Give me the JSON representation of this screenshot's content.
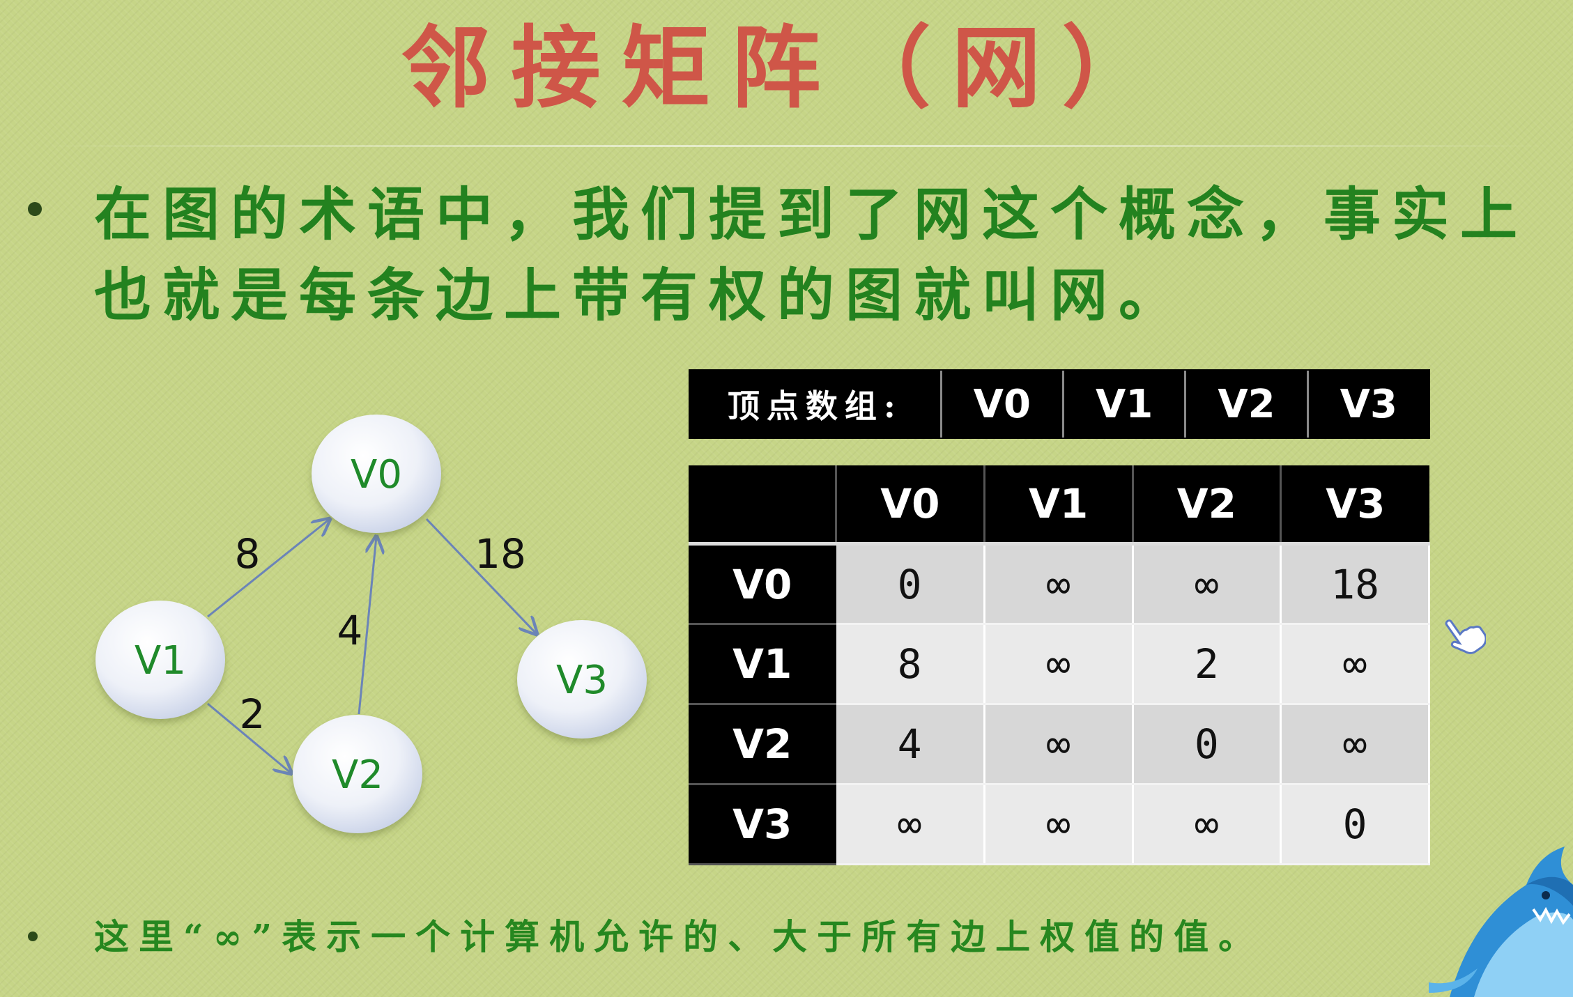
{
  "slide": {
    "title": "邻接矩阵（网）",
    "paragraph1": "在图的术语中，我们提到了网这个概念，事实上也就是每条边上带有权的图就叫网。",
    "paragraph2": "这里“∞”表示一个计算机允许的、大于所有边上权值的值。"
  },
  "graph": {
    "nodes": {
      "v0": "V0",
      "v1": "V1",
      "v2": "V2",
      "v3": "V3"
    },
    "edges": {
      "v1_v0": "8",
      "v0_v3": "18",
      "v2_v0": "4",
      "v1_v2": "2"
    }
  },
  "vertex_array": {
    "header": "顶点数组:",
    "items": [
      "V0",
      "V1",
      "V2",
      "V3"
    ]
  },
  "matrix": {
    "columns": [
      "V0",
      "V1",
      "V2",
      "V3"
    ],
    "rows": [
      {
        "label": "V0",
        "cells": [
          "0",
          "∞",
          "∞",
          "18"
        ]
      },
      {
        "label": "V1",
        "cells": [
          "8",
          "∞",
          "2",
          "∞"
        ]
      },
      {
        "label": "V2",
        "cells": [
          "4",
          "∞",
          "0",
          "∞"
        ]
      },
      {
        "label": "V3",
        "cells": [
          "∞",
          "∞",
          "∞",
          "0"
        ]
      }
    ]
  },
  "icons": {
    "cursor": "pointing-hand-icon",
    "mascot": "shark-mascot"
  },
  "colors": {
    "title": "#cf5648",
    "text": "#23821f",
    "background": "#c6d587"
  }
}
